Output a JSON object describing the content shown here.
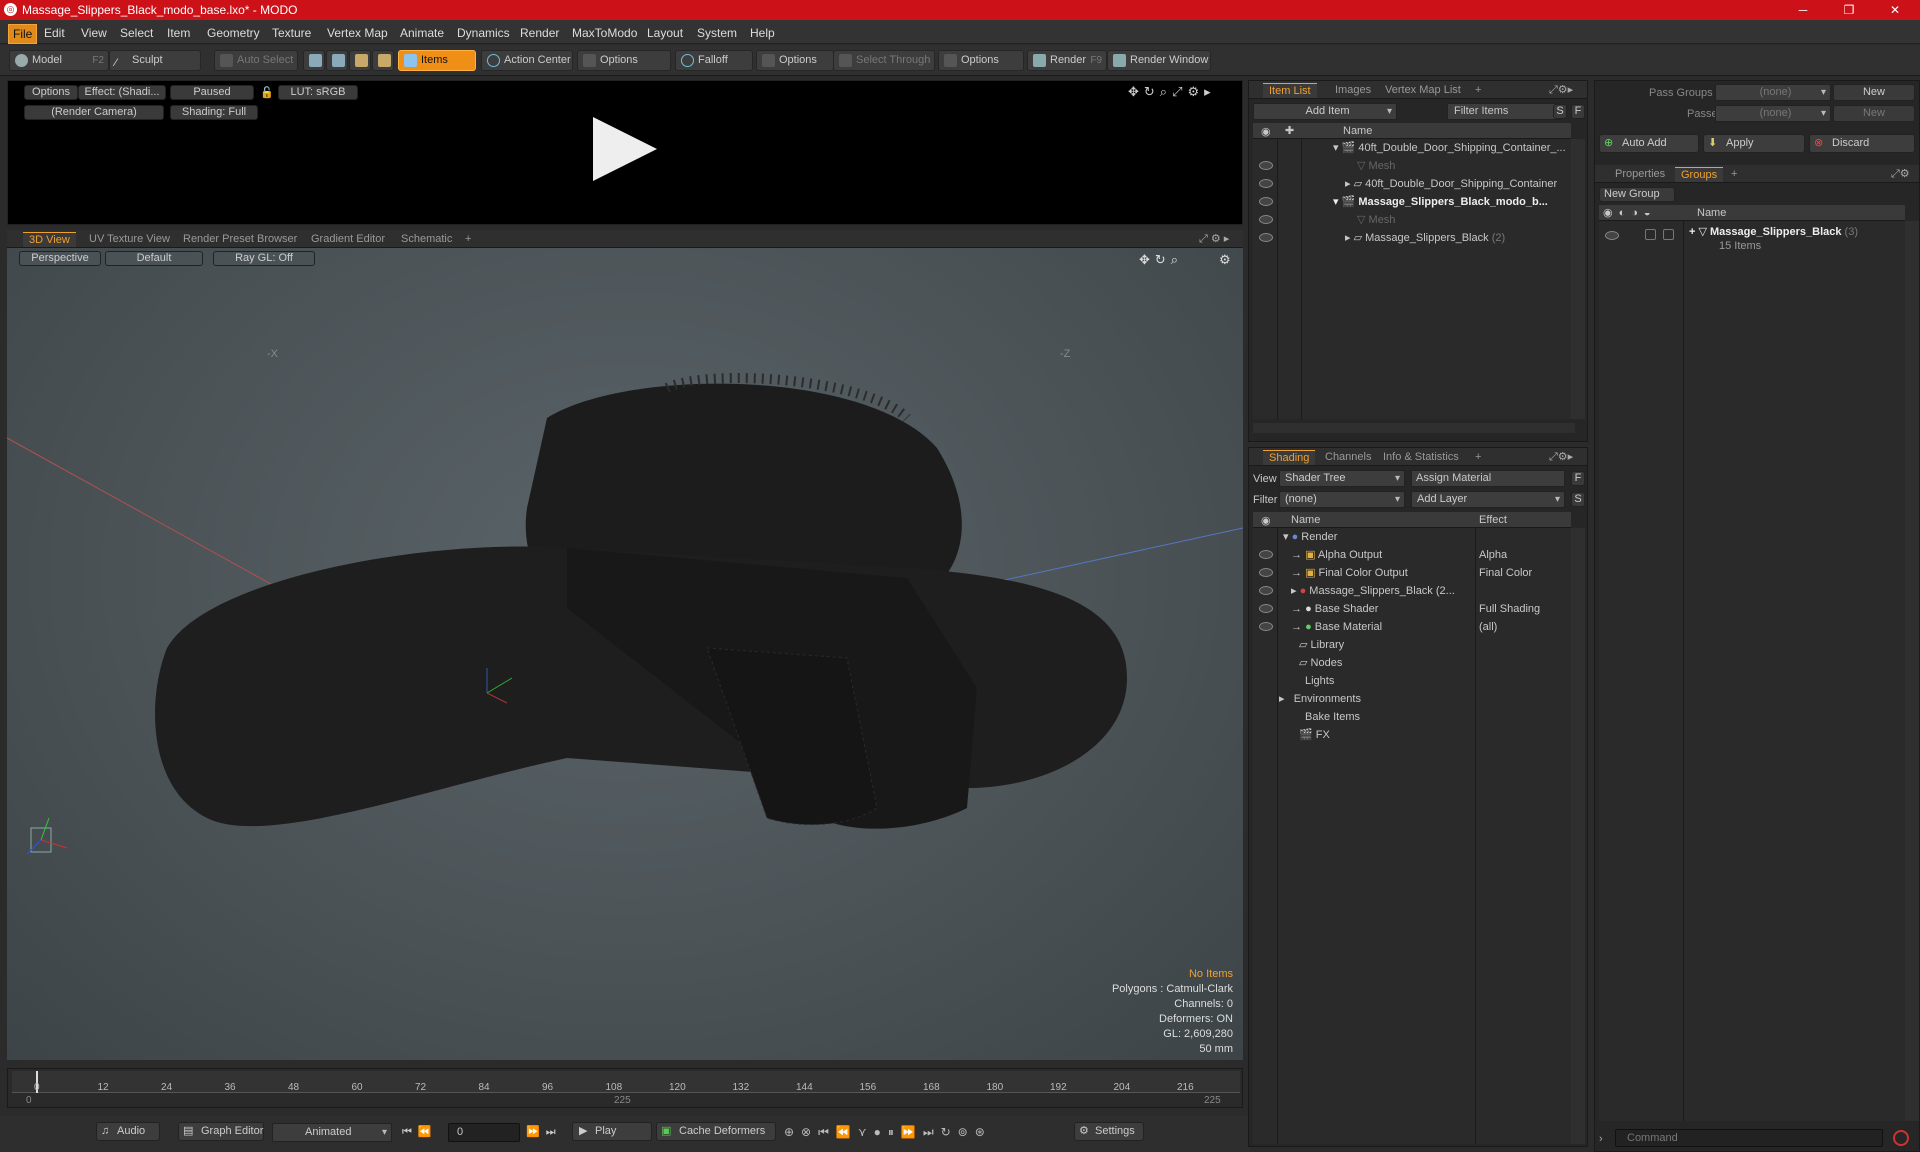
{
  "window": {
    "title": "Massage_Slippers_Black_modo_base.lxo* - MODO",
    "min": "─",
    "max": "❐",
    "close": "✕"
  },
  "menu": [
    "File",
    "Edit",
    "View",
    "Select",
    "Item",
    "Geometry",
    "Texture",
    "Vertex Map",
    "Animate",
    "Dynamics",
    "Render",
    "MaxToModo",
    "Layout",
    "System",
    "Help"
  ],
  "toolbar": {
    "model": "Model",
    "model_key": "F2",
    "sculpt": "Sculpt",
    "auto_select": "Auto Select",
    "items": "Items",
    "action_center": "Action Center",
    "options1": "Options",
    "falloff": "Falloff",
    "options2": "Options",
    "select_through": "Select Through",
    "options3": "Options",
    "render": "Render",
    "render_key": "F9",
    "render_window": "Render Window"
  },
  "preview": {
    "options": "Options",
    "effect": "Effect: (Shadi...",
    "paused": "Paused",
    "lut": "LUT: sRGB",
    "camera": "(Render Camera)",
    "shading": "Shading: Full"
  },
  "view_tabs": [
    "3D View",
    "UV Texture View",
    "Render Preset Browser",
    "Gradient Editor",
    "Schematic",
    "+"
  ],
  "view_opts": {
    "perspective": "Perspective",
    "default": "Default",
    "raygl": "Ray GL: Off"
  },
  "axis_labels": {
    "x": "-X",
    "z": "-Z"
  },
  "stats": {
    "no_items": "No Items",
    "polygons": "Polygons : Catmull-Clark",
    "channels": "Channels: 0",
    "deformers": "Deformers: ON",
    "gl": "GL: 2,609,280",
    "size": "50 mm"
  },
  "timeline": {
    "ticks": [
      "0",
      "12",
      "24",
      "36",
      "48",
      "60",
      "72",
      "84",
      "96",
      "108",
      "120",
      "132",
      "144",
      "156",
      "168",
      "180",
      "192",
      "204",
      "216"
    ],
    "start": "0",
    "mid": "225",
    "end": "225"
  },
  "bottombar": {
    "audio": "Audio",
    "graph_editor": "Graph Editor",
    "animated": "Animated",
    "frame": "0",
    "play": "Play",
    "cache": "Cache Deformers",
    "settings": "Settings"
  },
  "itemlist": {
    "tabs": [
      "Item List",
      "Images",
      "Vertex Map List",
      "+"
    ],
    "add_item": "Add Item",
    "filter": "Filter Items",
    "s": "S",
    "f": "F",
    "col_name": "Name",
    "rows": [
      {
        "label": "40ft_Double_Door_Shipping_Container_...",
        "indent": 0,
        "bold": false
      },
      {
        "label": "Mesh",
        "indent": 1,
        "bold": false,
        "dim": true
      },
      {
        "label": "40ft_Double_Door_Shipping_Container",
        "indent": 1,
        "bold": false
      },
      {
        "label": "Massage_Slippers_Black_modo_b...",
        "indent": 0,
        "bold": true
      },
      {
        "label": "Mesh",
        "indent": 1,
        "bold": false,
        "dim": true
      },
      {
        "label": "Massage_Slippers_Black",
        "indent": 1,
        "bold": false,
        "count": "(2)"
      }
    ]
  },
  "shading": {
    "tabs": [
      "Shading",
      "Channels",
      "Info & Statistics",
      "+"
    ],
    "view_label": "View",
    "view_value": "Shader Tree",
    "assign": "Assign Material",
    "f": "F",
    "filter_label": "Filter",
    "filter_value": "(none)",
    "add_layer": "Add Layer",
    "s": "S",
    "col_name": "Name",
    "col_effect": "Effect",
    "rows": [
      {
        "label": "Render",
        "effect": ""
      },
      {
        "label": "Alpha Output",
        "effect": "Alpha"
      },
      {
        "label": "Final Color Output",
        "effect": "Final Color"
      },
      {
        "label": "Massage_Slippers_Black (2...",
        "effect": ""
      },
      {
        "label": "Base Shader",
        "effect": "Full Shading"
      },
      {
        "label": "Base Material",
        "effect": "(all)"
      },
      {
        "label": "Library",
        "effect": ""
      },
      {
        "label": "Nodes",
        "effect": ""
      },
      {
        "label": "Lights",
        "effect": ""
      },
      {
        "label": "Environments",
        "effect": ""
      },
      {
        "label": "Bake Items",
        "effect": ""
      },
      {
        "label": "FX",
        "effect": ""
      }
    ]
  },
  "groups": {
    "pass_groups": "Pass Groups",
    "pass_value": "(none)",
    "new1": "New",
    "passes": "Passes",
    "passes_value": "(none)",
    "new2": "New",
    "auto_add": "Auto Add",
    "apply": "Apply",
    "discard": "Discard",
    "tabs": [
      "Properties",
      "Groups",
      "+"
    ],
    "new_group": "New Group",
    "col_name": "Name",
    "group_name": "Massage_Slippers_Black",
    "group_count": "(3)",
    "group_items": "15 Items"
  },
  "command": {
    "placeholder": "Command"
  },
  "colors": {
    "accent": "#f08f16",
    "title_red": "#cc1119"
  }
}
